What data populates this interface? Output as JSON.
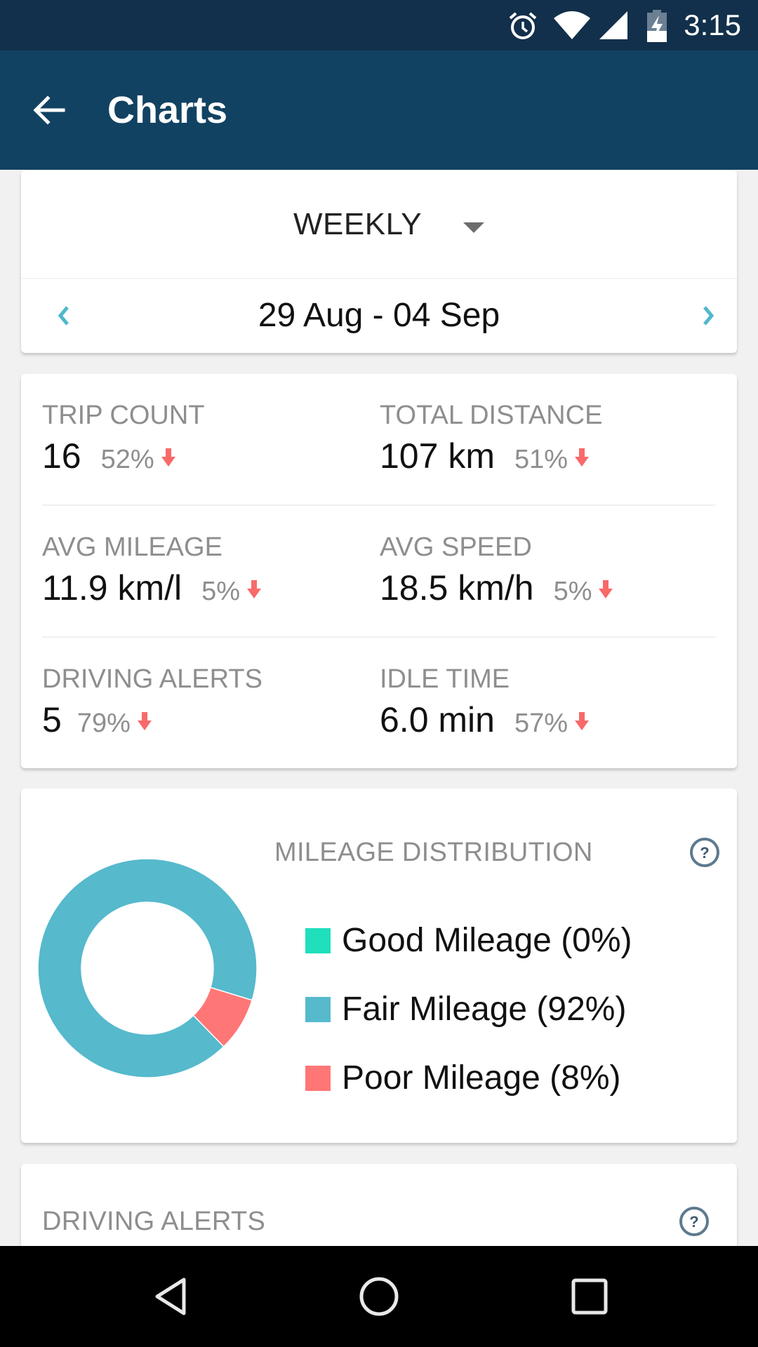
{
  "status_bar": {
    "time": "3:15",
    "icons": [
      "alarm-icon",
      "wifi-icon",
      "cell-signal-icon",
      "battery-charging-icon"
    ]
  },
  "app_bar": {
    "back_icon": "arrow-left-icon",
    "title": "Charts"
  },
  "period": {
    "selected": "WEEKLY",
    "dropdown_icon": "caret-down-icon",
    "date_range": "29 Aug - 04 Sep",
    "prev_icon": "chevron-left-icon",
    "next_icon": "chevron-right-icon"
  },
  "stats": [
    {
      "label": "TRIP COUNT",
      "value": "16",
      "change": "52%",
      "trend": "down"
    },
    {
      "label": "TOTAL DISTANCE",
      "value": "107 km",
      "change": "51%",
      "trend": "down"
    },
    {
      "label": "AVG MILEAGE",
      "value": "11.9 km/l",
      "change": "5%",
      "trend": "down"
    },
    {
      "label": "AVG SPEED",
      "value": "18.5 km/h",
      "change": "5%",
      "trend": "down"
    },
    {
      "label": "DRIVING ALERTS",
      "value": "5",
      "change": "79%",
      "trend": "down"
    },
    {
      "label": "IDLE TIME",
      "value": "6.0 min",
      "change": "57%",
      "trend": "down"
    }
  ],
  "colors": {
    "status_bar": "#12304b",
    "app_bar": "#124262",
    "accent": "#4fb8cc",
    "trend_down": "#f86a6a",
    "good": "#1fdfbd",
    "fair": "#56b9cc",
    "poor": "#ff7676"
  },
  "mileage": {
    "title": "MILEAGE DISTRIBUTION",
    "help_icon": "help-circle-icon",
    "legend": [
      {
        "label": "Good Mileage (0%)"
      },
      {
        "label": "Fair Mileage (92%)"
      },
      {
        "label": "Poor Mileage (8%)"
      }
    ]
  },
  "chart_data": {
    "type": "pie",
    "variant": "donut",
    "title": "MILEAGE DISTRIBUTION",
    "categories": [
      "Good Mileage",
      "Fair Mileage",
      "Poor Mileage"
    ],
    "values": [
      0,
      92,
      8
    ],
    "unit": "%",
    "colors": [
      "#1fdfbd",
      "#56b9cc",
      "#ff7676"
    ],
    "legend_position": "right"
  },
  "alerts": {
    "title": "DRIVING ALERTS",
    "help_icon": "help-circle-icon"
  },
  "nav_bar": {
    "icons": [
      "nav-back-icon",
      "nav-home-icon",
      "nav-recents-icon"
    ]
  }
}
